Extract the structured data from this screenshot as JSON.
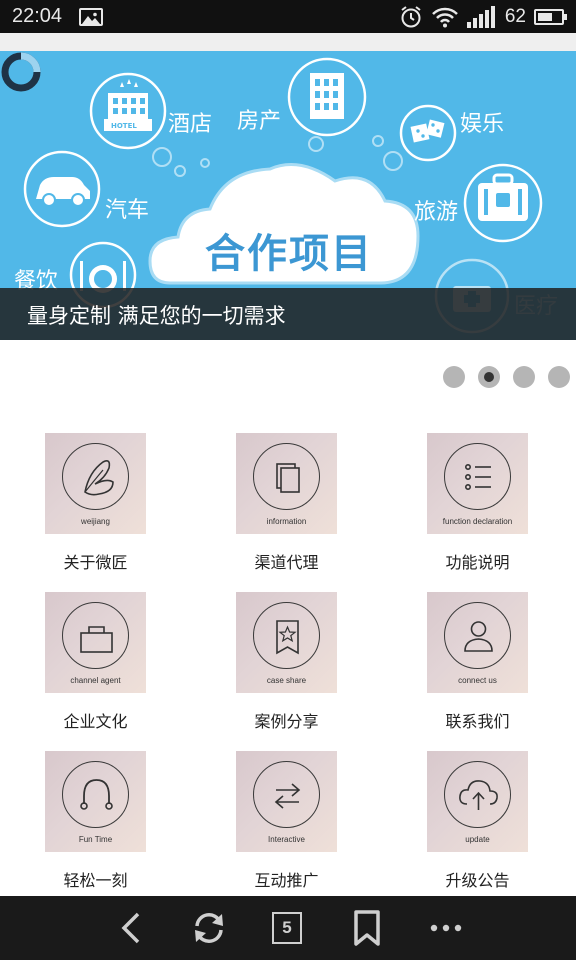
{
  "status": {
    "time": "22:04",
    "battery": "62",
    "battery_level": 0.62
  },
  "banner": {
    "labels": {
      "hotel": "酒店",
      "realestate": "房产",
      "entertainment": "娱乐",
      "car": "汽车",
      "travel": "旅游",
      "dining": "餐饮",
      "medical": "医疗"
    },
    "hotel_sign": "HOTEL",
    "cloud_title": "合作项目",
    "caption": "量身定制 满足您的一切需求"
  },
  "pager": {
    "count": 4,
    "active": 1
  },
  "grid": [
    {
      "en": "weijiang",
      "label": "关于微匠",
      "icon": "butterfly-icon"
    },
    {
      "en": "information",
      "label": "渠道代理",
      "icon": "documents-icon"
    },
    {
      "en": "function declaration",
      "label": "功能说明",
      "icon": "list-icon"
    },
    {
      "en": "channel agent",
      "label": "企业文化",
      "icon": "bag-icon"
    },
    {
      "en": "case share",
      "label": "案例分享",
      "icon": "star-bookmark-icon"
    },
    {
      "en": "connect us",
      "label": "联系我们",
      "icon": "person-icon"
    },
    {
      "en": "Fun Time",
      "label": "轻松一刻",
      "icon": "headphones-icon"
    },
    {
      "en": "Interactive",
      "label": "互动推广",
      "icon": "arrows-icon"
    },
    {
      "en": "update",
      "label": "升级公告",
      "icon": "cloud-upload-icon"
    }
  ],
  "bottom_nav": {
    "tab_count": "5",
    "icons": [
      "back-icon",
      "refresh-icon",
      "tabs-icon",
      "bookmark-icon",
      "more-icon"
    ]
  }
}
